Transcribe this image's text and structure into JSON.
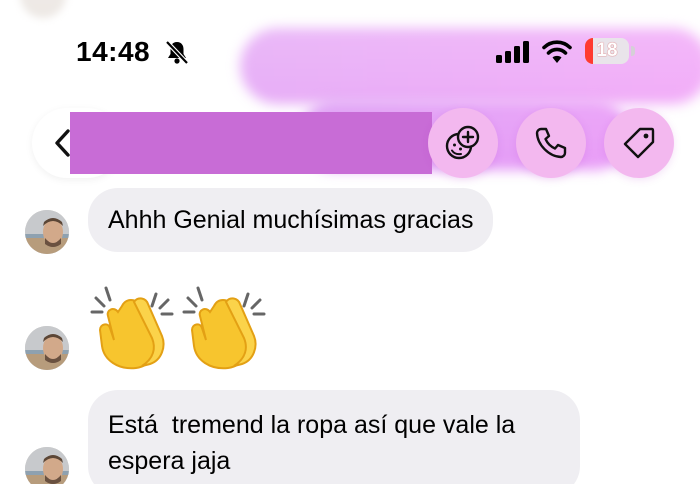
{
  "status_bar": {
    "time": "14:48",
    "battery_level": "18",
    "battery_fraction": 0.18
  },
  "header": {
    "icons": [
      "chevron-left-icon",
      "add-emoji-icon",
      "phone-icon",
      "tag-icon"
    ]
  },
  "messages": [
    {
      "type": "text",
      "text": "Ahhh Genial muchísimas gracias"
    },
    {
      "type": "emoji",
      "text": "👏👏"
    },
    {
      "type": "text",
      "text": "Está  tremend la ropa así que vale la espera jaja"
    }
  ],
  "colors": {
    "accent": "#f3b8ef",
    "redaction": "#c86cd6",
    "bubble": "#efeef2",
    "battery_low": "#ff3b30"
  }
}
